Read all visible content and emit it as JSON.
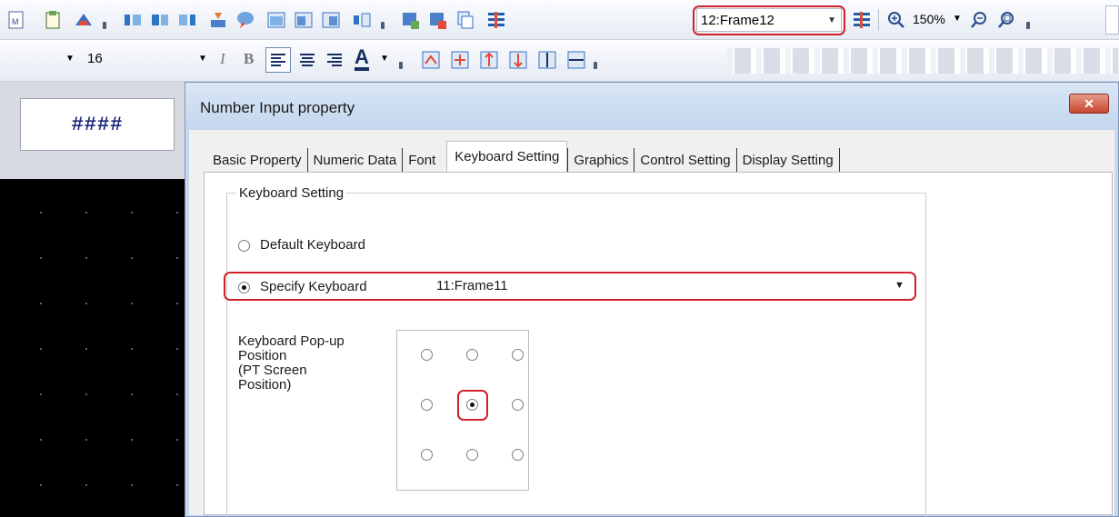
{
  "toolbar1": {
    "frame_select": "12:Frame12",
    "zoom": "150%"
  },
  "toolbar2": {
    "font_size": "16",
    "italic_label": "I",
    "bold_label": "B",
    "text_color_label": "A"
  },
  "canvas": {
    "object_text": "####"
  },
  "dialog": {
    "title": "Number Input property",
    "close_label": "✕",
    "tabs": [
      {
        "label": "Basic Property"
      },
      {
        "label": "Numeric Data"
      },
      {
        "label": "Font"
      },
      {
        "label": "Keyboard Setting"
      },
      {
        "label": "Graphics"
      },
      {
        "label": "Control Setting"
      },
      {
        "label": "Display Setting"
      }
    ],
    "active_tab": "Keyboard Setting",
    "keyboard_group": {
      "title": "Keyboard Setting",
      "default_label": "Default Keyboard",
      "specify_label": "Specify Keyboard",
      "specify_selected": true,
      "keyboard_value": "11:Frame11",
      "popup_label_1": "Keyboard Pop-up",
      "popup_label_2": "Position",
      "popup_label_3": "(PT Screen",
      "popup_label_4": "Position)",
      "popup_selected": "middle-center"
    }
  },
  "colors": {
    "highlight": "#d0202a",
    "dialog_frame": "#c8d8ec"
  }
}
